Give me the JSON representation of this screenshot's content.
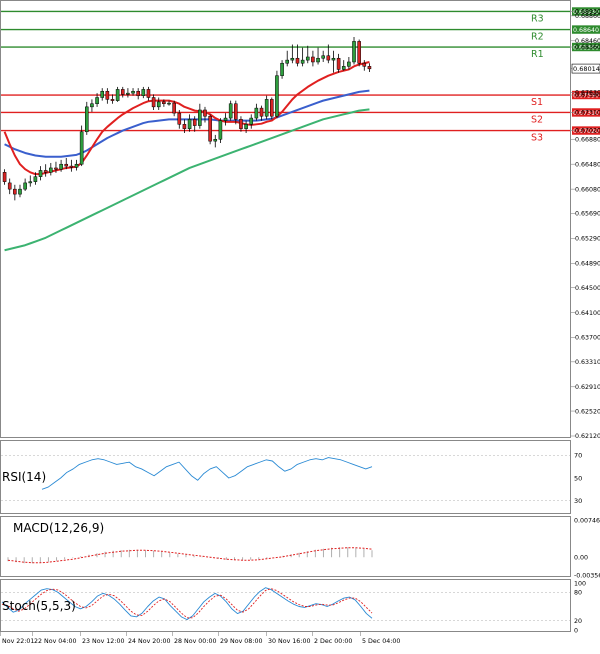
{
  "colors": {
    "candle_up": "#2e9e3e",
    "candle_down": "#d62424",
    "resistance": "#2e8b2e",
    "support": "#e02020",
    "ma_fast": "#e02020",
    "ma_mid": "#3a5fcd",
    "ma_slow": "#3cb371",
    "rsi": "#2a8ad4",
    "stoch_main": "#2a8ad4",
    "stoch_signal": "#e02020",
    "macd_hist": "#b0b0b0",
    "macd_signal": "#e02020",
    "grid": "#e6e6e6",
    "pane_border": "#888888"
  },
  "chart_data": [
    {
      "type": "candlestick",
      "pane": "price",
      "title": "",
      "ylim": [
        0.6212,
        0.6905
      ],
      "y_ticks": [
        "0.68930",
        "0.68860",
        "0.68460",
        "0.68360",
        "0.68014",
        "0.67630",
        "0.67590",
        "0.67310",
        "0.67020",
        "0.66880",
        "0.66480",
        "0.66080",
        "0.65690",
        "0.65290",
        "0.64890",
        "0.64500",
        "0.64100",
        "0.63700",
        "0.63310",
        "0.62910",
        "0.62520",
        "0.62120"
      ],
      "x_ticks": [
        "Nov 22:01",
        "22 Nov 04:00",
        "23 Nov 12:00",
        "24 Nov 20:00",
        "28 Nov 00:00",
        "29 Nov 08:00",
        "30 Nov 16:00",
        "2 Dec 00:00",
        "5 Dec 04:00"
      ],
      "levels": [
        {
          "label": "R3",
          "value": 0.6893,
          "kind": "resistance"
        },
        {
          "label": "R2",
          "value": 0.6864,
          "kind": "resistance"
        },
        {
          "label": "R1",
          "value": 0.6836,
          "kind": "resistance"
        },
        {
          "label": "S1",
          "value": 0.6759,
          "kind": "support"
        },
        {
          "label": "S2",
          "value": 0.6731,
          "kind": "support"
        },
        {
          "label": "S3",
          "value": 0.6702,
          "kind": "support"
        }
      ],
      "current_price": "0.68014",
      "candles": [
        [
          0.6635,
          0.662,
          0.664,
          0.6615
        ],
        [
          0.6618,
          0.6608,
          0.6625,
          0.66
        ],
        [
          0.6608,
          0.66,
          0.6615,
          0.659
        ],
        [
          0.66,
          0.6608,
          0.6615,
          0.6595
        ],
        [
          0.6608,
          0.6618,
          0.6625,
          0.6605
        ],
        [
          0.6618,
          0.662,
          0.663,
          0.6612
        ],
        [
          0.662,
          0.6628,
          0.6635,
          0.6615
        ],
        [
          0.6628,
          0.6638,
          0.6645,
          0.6622
        ],
        [
          0.6638,
          0.6635,
          0.6648,
          0.6628
        ],
        [
          0.6635,
          0.6642,
          0.665,
          0.663
        ],
        [
          0.6642,
          0.664,
          0.6652,
          0.6634
        ],
        [
          0.664,
          0.6648,
          0.6655,
          0.6636
        ],
        [
          0.6648,
          0.6645,
          0.6658,
          0.664
        ],
        [
          0.6645,
          0.6643,
          0.6655,
          0.6636
        ],
        [
          0.6643,
          0.6648,
          0.6655,
          0.6638
        ],
        [
          0.6648,
          0.67,
          0.671,
          0.6645
        ],
        [
          0.67,
          0.674,
          0.6748,
          0.6695
        ],
        [
          0.674,
          0.6745,
          0.6752,
          0.6732
        ],
        [
          0.6745,
          0.6755,
          0.6762,
          0.674
        ],
        [
          0.6755,
          0.6765,
          0.677,
          0.675
        ],
        [
          0.6765,
          0.6752,
          0.677,
          0.6745
        ],
        [
          0.6752,
          0.675,
          0.676,
          0.6745
        ],
        [
          0.675,
          0.6768,
          0.6772,
          0.6748
        ],
        [
          0.6768,
          0.676,
          0.6772,
          0.6755
        ],
        [
          0.676,
          0.6762,
          0.677,
          0.6755
        ],
        [
          0.6762,
          0.6765,
          0.677,
          0.6758
        ],
        [
          0.6765,
          0.6758,
          0.677,
          0.6752
        ],
        [
          0.6758,
          0.6768,
          0.6772,
          0.6754
        ],
        [
          0.6768,
          0.6755,
          0.6772,
          0.675
        ],
        [
          0.6755,
          0.674,
          0.676,
          0.6735
        ],
        [
          0.674,
          0.6748,
          0.6755,
          0.6735
        ],
        [
          0.6748,
          0.6745,
          0.6752,
          0.674
        ],
        [
          0.6745,
          0.6746,
          0.675,
          0.6742
        ],
        [
          0.6746,
          0.673,
          0.675,
          0.6725
        ],
        [
          0.673,
          0.6712,
          0.6735,
          0.6705
        ],
        [
          0.6712,
          0.6705,
          0.672,
          0.6698
        ],
        [
          0.6705,
          0.672,
          0.6728,
          0.67
        ],
        [
          0.672,
          0.671,
          0.6725,
          0.67
        ],
        [
          0.671,
          0.6735,
          0.6745,
          0.6705
        ],
        [
          0.6735,
          0.6725,
          0.674,
          0.6715
        ],
        [
          0.6725,
          0.6685,
          0.6728,
          0.668
        ],
        [
          0.6685,
          0.6688,
          0.6695,
          0.6675
        ],
        [
          0.6688,
          0.6718,
          0.6722,
          0.6682
        ],
        [
          0.6718,
          0.6722,
          0.673,
          0.671
        ],
        [
          0.6722,
          0.6745,
          0.675,
          0.6718
        ],
        [
          0.6745,
          0.672,
          0.675,
          0.6712
        ],
        [
          0.672,
          0.6705,
          0.6725,
          0.67
        ],
        [
          0.6705,
          0.6712,
          0.6718,
          0.6698
        ],
        [
          0.6712,
          0.6722,
          0.6728,
          0.6705
        ],
        [
          0.6722,
          0.6738,
          0.6745,
          0.6718
        ],
        [
          0.6738,
          0.6725,
          0.6742,
          0.6718
        ],
        [
          0.6725,
          0.6752,
          0.6758,
          0.672
        ],
        [
          0.6752,
          0.6725,
          0.6755,
          0.672
        ],
        [
          0.6725,
          0.679,
          0.6798,
          0.6722
        ],
        [
          0.679,
          0.681,
          0.6815,
          0.6785
        ],
        [
          0.681,
          0.6815,
          0.683,
          0.6805
        ],
        [
          0.6815,
          0.6818,
          0.684,
          0.681
        ],
        [
          0.6818,
          0.681,
          0.684,
          0.6805
        ],
        [
          0.681,
          0.6815,
          0.6835,
          0.6805
        ],
        [
          0.6815,
          0.682,
          0.6838,
          0.681
        ],
        [
          0.682,
          0.6812,
          0.683,
          0.6805
        ],
        [
          0.6812,
          0.6818,
          0.6835,
          0.6808
        ],
        [
          0.6818,
          0.6822,
          0.683,
          0.6812
        ],
        [
          0.6822,
          0.6815,
          0.684,
          0.681
        ],
        [
          0.6815,
          0.6818,
          0.683,
          0.6795
        ],
        [
          0.6818,
          0.68,
          0.6825,
          0.6795
        ],
        [
          0.68,
          0.6805,
          0.6815,
          0.6798
        ],
        [
          0.6805,
          0.6812,
          0.682,
          0.68
        ],
        [
          0.6812,
          0.6845,
          0.6852,
          0.6808
        ],
        [
          0.6845,
          0.681,
          0.6848,
          0.6805
        ],
        [
          0.681,
          0.6805,
          0.6815,
          0.6798
        ],
        [
          0.6805,
          0.6801,
          0.681,
          0.6796
        ]
      ],
      "ma_fast": [
        0.67,
        0.668,
        0.6662,
        0.6648,
        0.664,
        0.6635,
        0.6632,
        0.6632,
        0.6634,
        0.6636,
        0.6638,
        0.664,
        0.6642,
        0.6643,
        0.6644,
        0.665,
        0.6662,
        0.6675,
        0.6688,
        0.67,
        0.6708,
        0.6715,
        0.6722,
        0.6728,
        0.6733,
        0.6738,
        0.6742,
        0.6746,
        0.6749,
        0.675,
        0.675,
        0.675,
        0.675,
        0.6748,
        0.6745,
        0.674,
        0.6737,
        0.6734,
        0.6733,
        0.6732,
        0.6728,
        0.6722,
        0.6718,
        0.6716,
        0.6716,
        0.6716,
        0.6714,
        0.6712,
        0.6711,
        0.6712,
        0.6713,
        0.6716,
        0.6718,
        0.6724,
        0.6732,
        0.6742,
        0.6752,
        0.676,
        0.6766,
        0.6772,
        0.6777,
        0.6782,
        0.6786,
        0.679,
        0.6793,
        0.6796,
        0.6798,
        0.68,
        0.6805,
        0.6808,
        0.681,
        0.6812
      ],
      "ma_mid": [
        0.668,
        0.6676,
        0.6672,
        0.6669,
        0.6666,
        0.6664,
        0.6662,
        0.6661,
        0.666,
        0.666,
        0.666,
        0.666,
        0.6661,
        0.6662,
        0.6663,
        0.6666,
        0.667,
        0.6675,
        0.668,
        0.6685,
        0.669,
        0.6694,
        0.6698,
        0.6702,
        0.6705,
        0.6708,
        0.6711,
        0.6714,
        0.6716,
        0.6717,
        0.6718,
        0.6719,
        0.672,
        0.672,
        0.672,
        0.672,
        0.672,
        0.672,
        0.672,
        0.672,
        0.672,
        0.6719,
        0.6718,
        0.6718,
        0.6718,
        0.6718,
        0.6718,
        0.6718,
        0.6718,
        0.6718,
        0.6719,
        0.672,
        0.6721,
        0.6723,
        0.6726,
        0.6729,
        0.6732,
        0.6735,
        0.6738,
        0.6741,
        0.6744,
        0.6747,
        0.675,
        0.6752,
        0.6754,
        0.6756,
        0.6758,
        0.676,
        0.6762,
        0.6764,
        0.6765,
        0.6766
      ],
      "ma_slow": [
        0.651,
        0.6512,
        0.6514,
        0.6516,
        0.6518,
        0.6521,
        0.6524,
        0.6527,
        0.653,
        0.6534,
        0.6538,
        0.6542,
        0.6546,
        0.655,
        0.6554,
        0.6558,
        0.6562,
        0.6566,
        0.657,
        0.6574,
        0.6578,
        0.6582,
        0.6586,
        0.659,
        0.6594,
        0.6598,
        0.6602,
        0.6606,
        0.661,
        0.6614,
        0.6618,
        0.6622,
        0.6626,
        0.663,
        0.6634,
        0.6638,
        0.6642,
        0.6645,
        0.6648,
        0.6651,
        0.6654,
        0.6657,
        0.666,
        0.6663,
        0.6666,
        0.6669,
        0.6672,
        0.6675,
        0.6678,
        0.6681,
        0.6684,
        0.6687,
        0.669,
        0.6693,
        0.6696,
        0.6699,
        0.6702,
        0.6705,
        0.6708,
        0.6711,
        0.6714,
        0.6717,
        0.672,
        0.6722,
        0.6724,
        0.6726,
        0.6728,
        0.673,
        0.6732,
        0.6734,
        0.6735,
        0.6736
      ]
    },
    {
      "type": "line",
      "pane": "rsi",
      "title": "RSI(14)",
      "ylim": [
        20,
        80
      ],
      "y_ticks": [
        "70",
        "50",
        "30"
      ],
      "series": [
        {
          "values": [
            40,
            42,
            46,
            50,
            55,
            58,
            62,
            64,
            66,
            67,
            66,
            64,
            62,
            63,
            64,
            60,
            58,
            55,
            52,
            56,
            60,
            62,
            64,
            58,
            52,
            48,
            54,
            58,
            60,
            55,
            50,
            52,
            56,
            60,
            62,
            64,
            66,
            65,
            60,
            56,
            58,
            62,
            64,
            66,
            67,
            66,
            68,
            67,
            66,
            64,
            62,
            60,
            58,
            60
          ]
        }
      ]
    },
    {
      "type": "bar",
      "pane": "macd",
      "title": "MACD(12,26,9)",
      "ylim": [
        -0.00356,
        0.00746
      ],
      "y_ticks": [
        "0.00746",
        "0.00",
        "-0.00356"
      ],
      "series": [
        {
          "values": [
            -0.0008,
            -0.001,
            -0.0012,
            -0.0012,
            -0.0011,
            -0.0009,
            -0.0007,
            -0.0004,
            -0.0001,
            0.0002,
            0.0005,
            0.0008,
            0.0011,
            0.0013,
            0.0014,
            0.0015,
            0.0015,
            0.0014,
            0.0013,
            0.0011,
            0.0009,
            0.0007,
            0.0005,
            0.0003,
            0.0001,
            -0.0001,
            -0.0003,
            -0.0005,
            -0.0006,
            -0.0006,
            -0.0005,
            -0.0004,
            -0.0002,
            0.0,
            0.0003,
            0.0006,
            0.0009,
            0.0012,
            0.0015,
            0.0017,
            0.0019,
            0.002,
            0.002,
            0.0019,
            0.0017,
            0.0014
          ]
        },
        {
          "values": [
            -0.0006,
            -0.0008,
            -0.001,
            -0.0011,
            -0.0011,
            -0.001,
            -0.0008,
            -0.0006,
            -0.0004,
            -0.0001,
            0.0002,
            0.0005,
            0.0008,
            0.001,
            0.0012,
            0.0013,
            0.0014,
            0.0014,
            0.0013,
            0.0012,
            0.001,
            0.0008,
            0.0006,
            0.0004,
            0.0002,
            0.0,
            -0.0002,
            -0.0004,
            -0.0005,
            -0.0006,
            -0.0006,
            -0.0005,
            -0.0003,
            -0.0001,
            0.0001,
            0.0004,
            0.0007,
            0.001,
            0.0013,
            0.0015,
            0.0017,
            0.0018,
            0.0019,
            0.0019,
            0.0018,
            0.0016
          ]
        }
      ]
    },
    {
      "type": "line",
      "pane": "stoch",
      "title": "Stoch(5,5,3)",
      "ylim": [
        0,
        100
      ],
      "y_ticks": [
        "100",
        "80",
        "20",
        "0"
      ],
      "series": [
        {
          "values": [
            60,
            48,
            38,
            42,
            55,
            65,
            75,
            85,
            88,
            86,
            80,
            70,
            60,
            50,
            45,
            50,
            60,
            72,
            78,
            74,
            66,
            55,
            42,
            30,
            28,
            36,
            50,
            62,
            70,
            66,
            52,
            40,
            28,
            22,
            30,
            45,
            60,
            70,
            78,
            72,
            60,
            45,
            35,
            40,
            55,
            70,
            82,
            90,
            86,
            78,
            70,
            62,
            55,
            50,
            48,
            52,
            56,
            54,
            50,
            55,
            62,
            68,
            70,
            64,
            50,
            35,
            25
          ]
        },
        {
          "values": [
            55,
            52,
            45,
            40,
            45,
            55,
            66,
            76,
            84,
            87,
            85,
            78,
            68,
            58,
            50,
            47,
            52,
            62,
            72,
            76,
            73,
            64,
            52,
            40,
            32,
            31,
            40,
            52,
            62,
            66,
            60,
            48,
            36,
            26,
            26,
            36,
            50,
            62,
            72,
            74,
            66,
            54,
            42,
            38,
            45,
            58,
            72,
            84,
            88,
            84,
            76,
            68,
            60,
            54,
            50,
            50,
            53,
            55,
            53,
            53,
            58,
            64,
            68,
            68,
            60,
            48,
            36
          ]
        }
      ]
    }
  ]
}
